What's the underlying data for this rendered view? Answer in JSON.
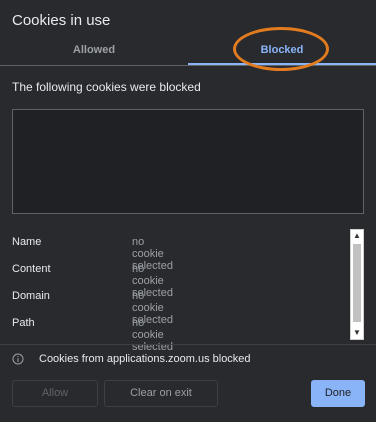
{
  "dialog": {
    "title": "Cookies in use",
    "tabs": [
      {
        "label": "Allowed",
        "selected": false
      },
      {
        "label": "Blocked",
        "selected": true
      }
    ],
    "subtitle": "The following cookies were blocked",
    "details": [
      {
        "label": "Name",
        "value": "no cookie selected"
      },
      {
        "label": "Content",
        "value": "no cookie selected"
      },
      {
        "label": "Domain",
        "value": "no cookie selected"
      },
      {
        "label": "Path",
        "value": "no cookie selected"
      }
    ],
    "status_text": "Cookies from applications.zoom.us blocked",
    "buttons": {
      "allow": "Allow",
      "clear_on_exit": "Clear on exit",
      "done": "Done"
    }
  },
  "colors": {
    "background": "#292a2d",
    "accent": "#8ab4f8",
    "highlight": "#e37c1f"
  }
}
